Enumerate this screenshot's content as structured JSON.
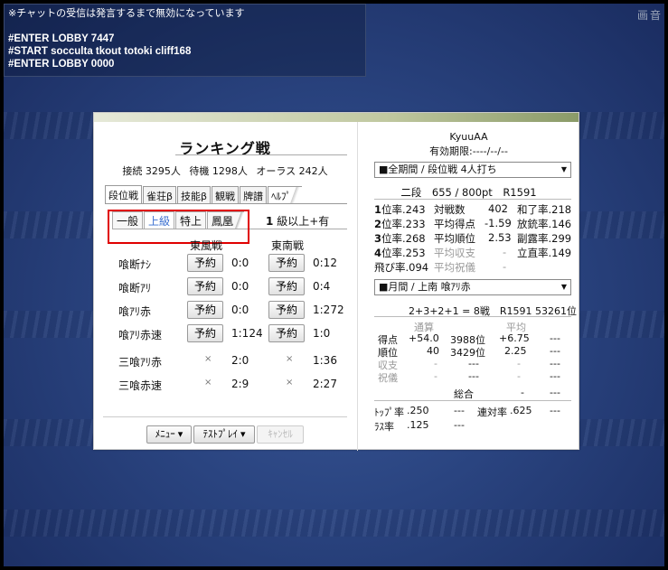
{
  "chat": {
    "notice": "※チャットの受信は発言するまで無効になっています",
    "lines": [
      "#ENTER LOBBY 7447",
      "#START socculta tkout totoki cliff168",
      "#ENTER LOBBY 0000"
    ]
  },
  "corner_toggles": "画音",
  "left": {
    "title": "ランキング戦",
    "counts": {
      "connected": "接続 3295人",
      "waiting": "待機 1298人",
      "all_last": "オーラス 242人"
    },
    "tabs": [
      "段位戦",
      "雀荘β",
      "技能β",
      "観戦",
      "牌譜",
      "ﾍﾙﾌﾟ"
    ],
    "subtabs": [
      "一般",
      "上級",
      "特上",
      "鳳凰"
    ],
    "level_note_strong": "1",
    "level_note": "級以上+有",
    "col_east": "東風戦",
    "col_south": "東南戦",
    "button_label": "予約",
    "rows": [
      {
        "name": "喰断ﾅｼ",
        "east": "0:0",
        "south": "0:12",
        "east_btn": true,
        "south_btn": true
      },
      {
        "name": "喰断ｱﾘ",
        "east": "0:0",
        "south": "0:4",
        "east_btn": true,
        "south_btn": true
      },
      {
        "name": "喰ｱﾘ赤",
        "east": "0:0",
        "south": "1:272",
        "east_btn": true,
        "south_btn": true
      },
      {
        "name": "喰ｱﾘ赤速",
        "east": "1:124",
        "south": "1:0",
        "east_btn": true,
        "south_btn": true
      },
      {
        "name": "三喰ｱﾘ赤",
        "east": "2:0",
        "south": "1:36",
        "east_btn": false,
        "south_btn": false
      },
      {
        "name": "三喰赤速",
        "east": "2:9",
        "south": "2:27",
        "east_btn": false,
        "south_btn": false
      }
    ],
    "disabled_mark": "×",
    "bottom_buttons": {
      "menu": "ﾒﾆｭｰ ▾",
      "test": "ﾃｽﾄﾌﾟﾚｲ ▾",
      "cancel": "ｷｬﾝｾﾙ"
    }
  },
  "right": {
    "username": "KyuuAA",
    "expiry": "有効期限:----/--/--",
    "period_select": "■全期間 / 段位戦 4人打ち",
    "rank_line": "二段　655 / 800pt　R1591",
    "stats": {
      "p1": "1",
      "p1v": "位率.243",
      "games_l": "対戦数",
      "games_v": "402",
      "win_l": "和了率",
      "win_v": ".218",
      "p2": "2",
      "p2v": "位率.233",
      "avgpt_l": "平均得点",
      "avgpt_v": "-1.59",
      "deal_l": "放銃率",
      "deal_v": ".146",
      "p3": "3",
      "p3v": "位率.268",
      "avgrank_l": "平均順位",
      "avgrank_v": "2.53",
      "call_l": "副露率",
      "call_v": ".299",
      "p4": "4",
      "p4v": "位率.253",
      "avgbal_l": "平均収支",
      "avgbal_v": "-",
      "riichi_l": "立直率",
      "riichi_v": ".149",
      "bust": "飛び率.094",
      "avgtip_l": "平均祝儀",
      "avgtip_v": "-"
    },
    "month_select": "■月間 / 上南 喰ｱﾘ赤",
    "month_summary": "2+3+2+1 = 8戦　R1591 53261位",
    "table_headers": {
      "total": "通算",
      "avg": "平均"
    },
    "table_rows": [
      {
        "label": "得点",
        "a": "+54.0",
        "b": "3988位",
        "c": "+6.75",
        "d": "---",
        "gray": false
      },
      {
        "label": "順位",
        "a": "40",
        "b": "3429位",
        "c": "2.25",
        "d": "---",
        "gray": false
      },
      {
        "label": "収支",
        "a": "-",
        "b": "---",
        "c": "-",
        "d": "---",
        "gray": true
      },
      {
        "label": "祝儀",
        "a": "-",
        "b": "---",
        "c": "-",
        "d": "---",
        "gray": true
      }
    ],
    "overall_label": "総合",
    "overall_c": "-",
    "overall_d": "---",
    "top_label": "ﾄｯﾌﾟ率",
    "top_v": ".250",
    "top_d": "---",
    "streak_label": "連対率",
    "streak_v": ".625",
    "streak_d": "---",
    "last_label": "ﾗｽ率",
    "last_v": ".125",
    "last_d": "---"
  }
}
